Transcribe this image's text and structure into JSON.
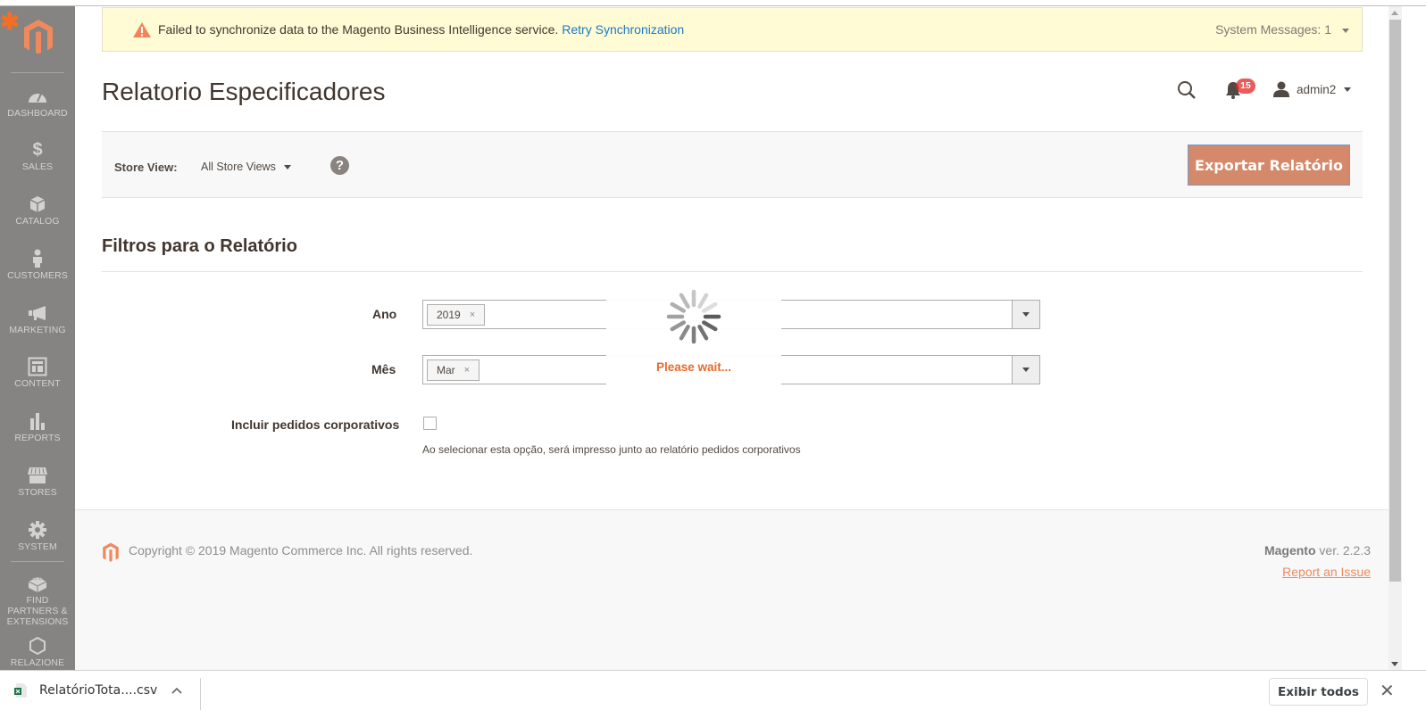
{
  "sidebar": {
    "logo": "magento-logo",
    "items": [
      {
        "label": "DASHBOARD",
        "icon": "dashboard-icon"
      },
      {
        "label": "SALES",
        "icon": "dollar-icon"
      },
      {
        "label": "CATALOG",
        "icon": "box-icon"
      },
      {
        "label": "CUSTOMERS",
        "icon": "person-icon"
      },
      {
        "label": "MARKETING",
        "icon": "megaphone-icon"
      },
      {
        "label": "CONTENT",
        "icon": "layout-icon"
      },
      {
        "label": "REPORTS",
        "icon": "bar-chart-icon"
      },
      {
        "label": "STORES",
        "icon": "storefront-icon"
      },
      {
        "label": "SYSTEM",
        "icon": "gear-icon"
      },
      {
        "label": "FIND PARTNERS & EXTENSIONS",
        "icon": "lego-brick-icon"
      },
      {
        "label": "RELAZIONE",
        "icon": "hexagon-icon"
      }
    ]
  },
  "system_message": {
    "text": "Failed to synchronize data to the Magento Business Intelligence service.",
    "link": "Retry Synchronization",
    "count_label": "System Messages: 1"
  },
  "header": {
    "title": "Relatorio Especificadores",
    "notifications_count": "15",
    "user": "admin2"
  },
  "toolbar": {
    "store_view_label": "Store View:",
    "store_view_value": "All Store Views",
    "help": "?",
    "export_button": "Exportar Relatório"
  },
  "filters": {
    "title": "Filtros para o Relatório",
    "ano": {
      "label": "Ano",
      "selected": "2019"
    },
    "mes": {
      "label": "Mês",
      "selected": "Mar"
    },
    "corporativos": {
      "label": "Incluir pedidos corporativos",
      "checked": false,
      "note": "Ao selecionar esta opção, será impresso junto ao relatório pedidos corporativos"
    },
    "remove_glyph": "×"
  },
  "loader": {
    "text": "Please wait..."
  },
  "footer": {
    "copyright": "Copyright © 2019 Magento Commerce Inc. All rights reserved.",
    "brand": "Magento",
    "version": " ver. 2.2.3",
    "report_link": "Report an Issue"
  },
  "download_bar": {
    "file_name": "RelatórioTota....csv",
    "show_all": "Exibir todos",
    "close": "✕"
  },
  "colors": {
    "accent": "#eb5202",
    "export_button": "#d4896a",
    "sidebar": "#858482",
    "message_bg": "#fffbd4",
    "link": "#1979c3"
  }
}
